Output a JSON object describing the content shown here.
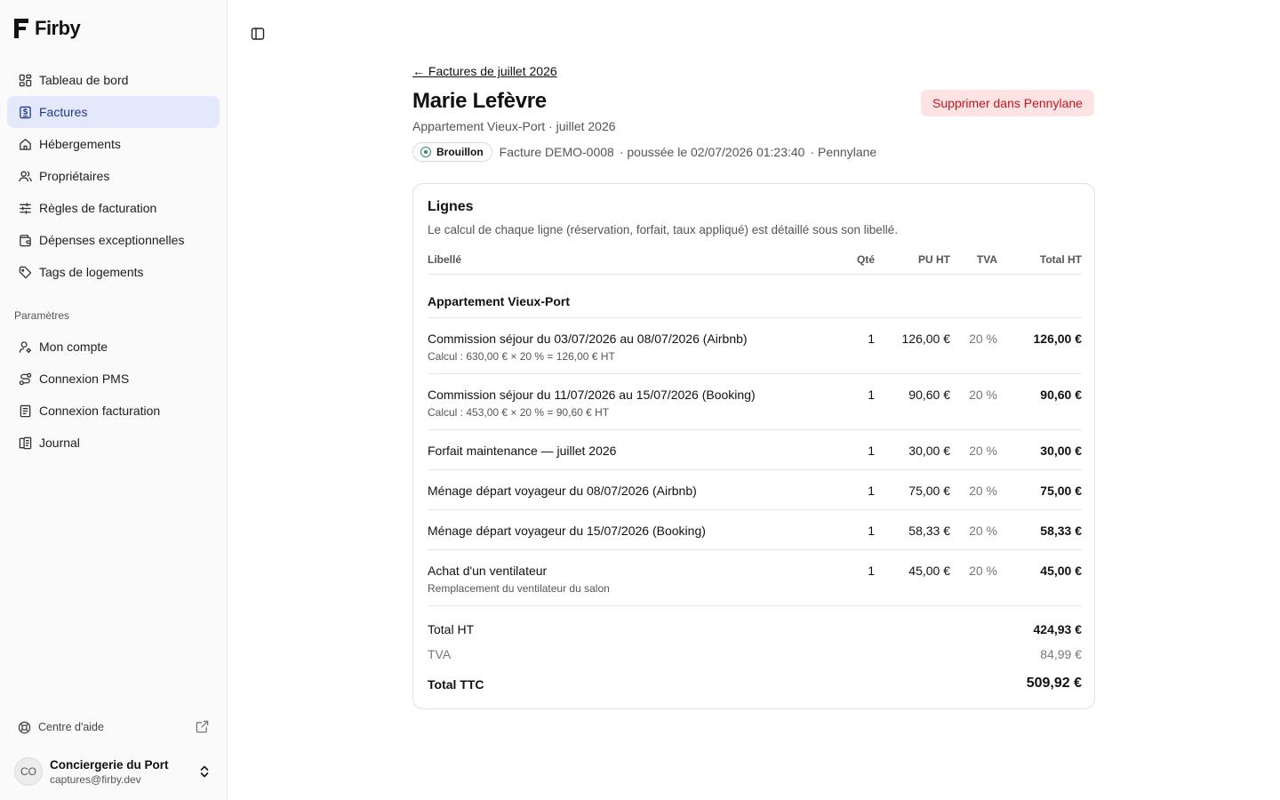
{
  "app": {
    "name": "Firby"
  },
  "sidebar": {
    "items": [
      {
        "label": "Tableau de bord",
        "icon": "dashboard-icon"
      },
      {
        "label": "Factures",
        "icon": "invoice-icon",
        "active": true
      },
      {
        "label": "Hébergements",
        "icon": "home-icon"
      },
      {
        "label": "Propriétaires",
        "icon": "users-icon"
      },
      {
        "label": "Règles de facturation",
        "icon": "sliders-icon"
      },
      {
        "label": "Dépenses exceptionnelles",
        "icon": "wallet-icon"
      },
      {
        "label": "Tags de logements",
        "icon": "tag-icon"
      }
    ],
    "settings_label": "Paramètres",
    "settings_items": [
      {
        "label": "Mon compte",
        "icon": "user-cog-icon"
      },
      {
        "label": "Connexion PMS",
        "icon": "route-icon"
      },
      {
        "label": "Connexion facturation",
        "icon": "receipt-icon"
      },
      {
        "label": "Journal",
        "icon": "logs-icon"
      }
    ],
    "help_label": "Centre d'aide",
    "account": {
      "initials": "CO",
      "name": "Conciergerie du Port",
      "email": "captures@firby.dev"
    }
  },
  "header": {
    "back_label": "← Factures de juillet 2026",
    "title": "Marie Lefèvre",
    "subtitle": "Appartement Vieux-Port · juillet 2026",
    "delete_label": "Supprimer dans Pennylane",
    "status": "Brouillon",
    "invoice_ref": "Facture DEMO-0008",
    "pushed": "· poussée le 02/07/2026 01:23:40",
    "provider": "· Pennylane"
  },
  "lines_card": {
    "title": "Lignes",
    "description": "Le calcul de chaque ligne (réservation, forfait, taux appliqué) est détaillé sous son libellé.",
    "columns": {
      "label": "Libellé",
      "qty": "Qté",
      "unit": "PU HT",
      "vat": "TVA",
      "total": "Total HT"
    },
    "group": "Appartement Vieux-Port",
    "rows": [
      {
        "label": "Commission séjour du 03/07/2026 au 08/07/2026 (Airbnb)",
        "detail": "Calcul : 630,00 € × 20 % = 126,00 € HT",
        "qty": "1",
        "unit": "126,00 €",
        "vat": "20 %",
        "total": "126,00 €"
      },
      {
        "label": "Commission séjour du 11/07/2026 au 15/07/2026 (Booking)",
        "detail": "Calcul : 453,00 € × 20 % = 90,60 € HT",
        "qty": "1",
        "unit": "90,60 €",
        "vat": "20 %",
        "total": "90,60 €"
      },
      {
        "label": "Forfait maintenance — juillet 2026",
        "qty": "1",
        "unit": "30,00 €",
        "vat": "20 %",
        "total": "30,00 €"
      },
      {
        "label": "Ménage départ voyageur du 08/07/2026 (Airbnb)",
        "qty": "1",
        "unit": "75,00 €",
        "vat": "20 %",
        "total": "75,00 €"
      },
      {
        "label": "Ménage départ voyageur du 15/07/2026 (Booking)",
        "qty": "1",
        "unit": "58,33 €",
        "vat": "20 %",
        "total": "58,33 €"
      },
      {
        "label": "Achat d'un ventilateur",
        "detail": "Remplacement du ventilateur du salon",
        "qty": "1",
        "unit": "45,00 €",
        "vat": "20 %",
        "total": "45,00 €"
      }
    ],
    "totals": {
      "ht_label": "Total HT",
      "ht": "424,93 €",
      "tva_label": "TVA",
      "tva": "84,99 €",
      "ttc_label": "Total TTC",
      "ttc": "509,92 €"
    }
  }
}
